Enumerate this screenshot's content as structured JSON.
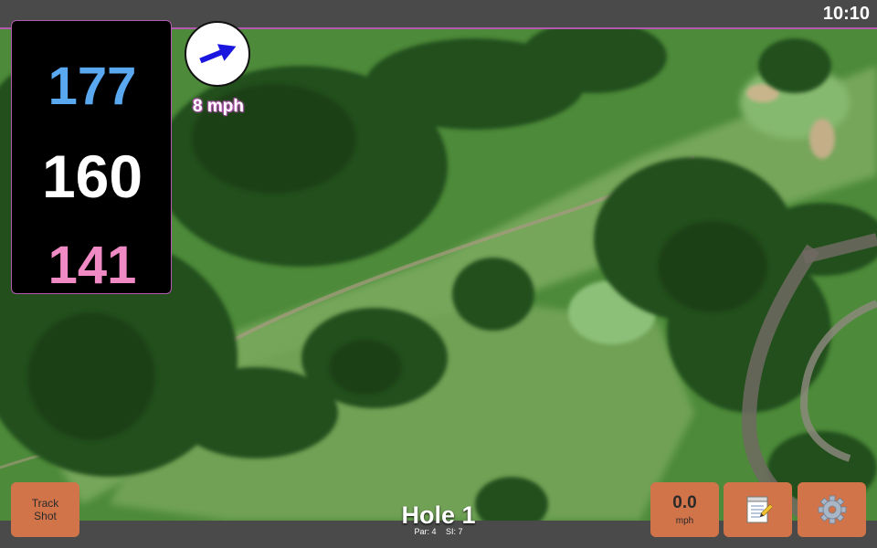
{
  "status": {
    "time": "10:10"
  },
  "distances": {
    "back": "177",
    "middle": "160",
    "front": "141"
  },
  "wind": {
    "speed_label": "8 mph",
    "direction": "east-north-east"
  },
  "hole": {
    "title": "Hole 1",
    "par_label": "Par: 4",
    "si_label": "SI: 7"
  },
  "buttons": {
    "track_shot": {
      "line1": "Track",
      "line2": "Shot"
    },
    "wind_reading": {
      "value": "0.0",
      "unit": "mph"
    },
    "notes": {
      "icon": "notepad-icon"
    },
    "settings": {
      "icon": "gear-icon"
    }
  },
  "colors": {
    "back": "#5aa8f0",
    "middle": "#ffffff",
    "front": "#f08ac4",
    "accent": "#b25ab0",
    "button": "#d2744a"
  }
}
